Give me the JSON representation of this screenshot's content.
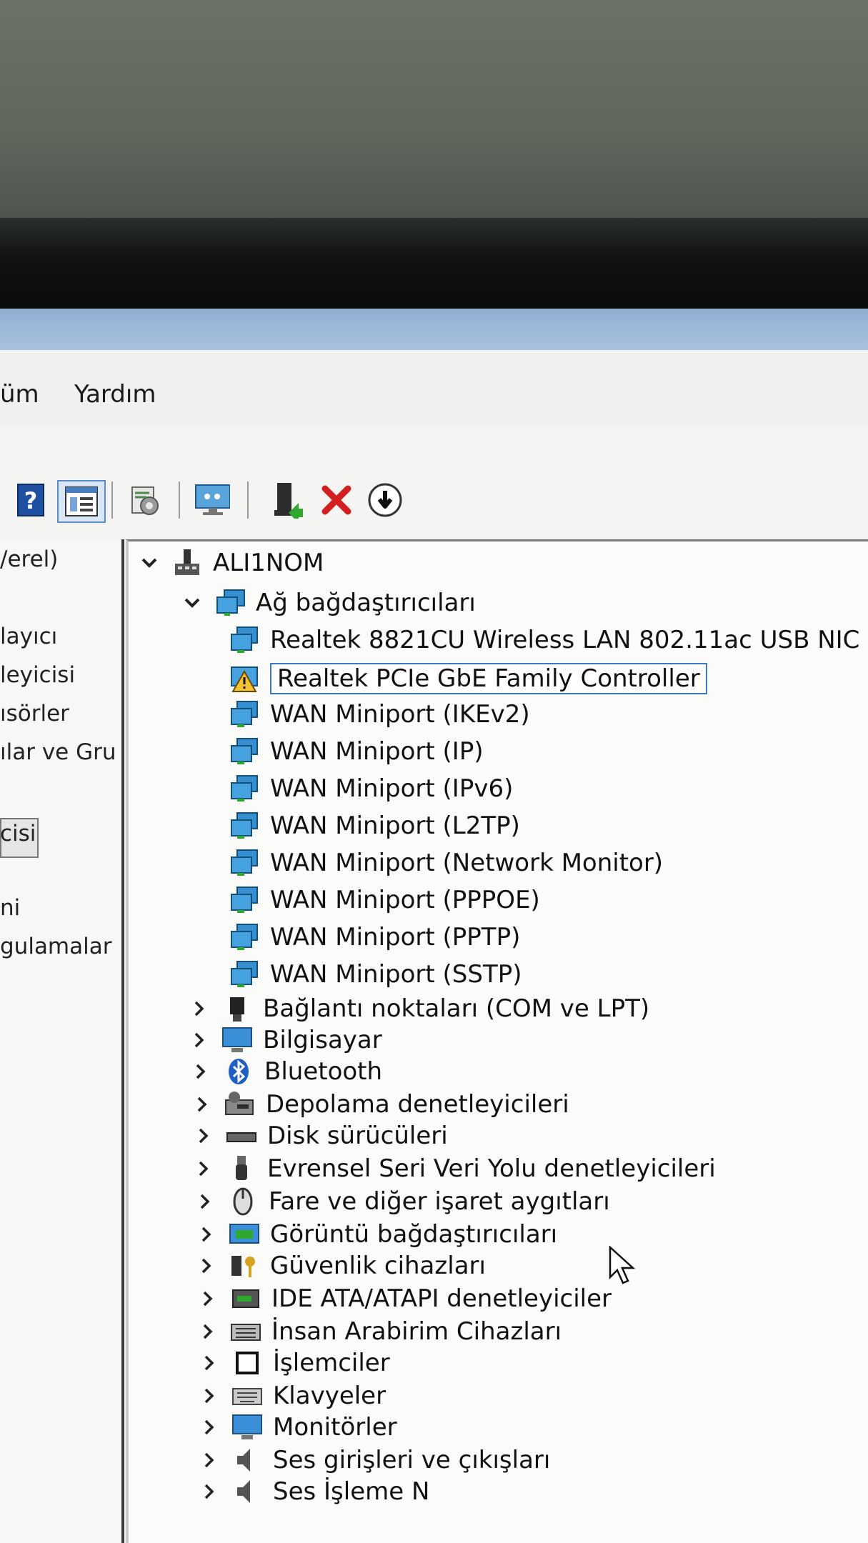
{
  "menu": {
    "item_0": "üm",
    "item_1": "Yardım"
  },
  "left_pane": {
    "items": [
      "/erel)",
      "layıcı",
      "leyicisi",
      "ısörler",
      "ılar ve Gru",
      "cisi",
      "ni",
      "gulamalar"
    ]
  },
  "tree": {
    "root": "ALI1NOM",
    "network_adapters": {
      "label": "Ağ bağdaştırıcıları",
      "children": [
        "Realtek 8821CU Wireless LAN 802.11ac USB NIC",
        "Realtek PCIe GbE Family Controller",
        "WAN Miniport (IKEv2)",
        "WAN Miniport (IP)",
        "WAN Miniport (IPv6)",
        "WAN Miniport (L2TP)",
        "WAN Miniport (Network Monitor)",
        "WAN Miniport (PPPOE)",
        "WAN Miniport (PPTP)",
        "WAN Miniport (SSTP)"
      ]
    },
    "categories": [
      {
        "label": "Bağlantı noktaları (COM ve LPT)",
        "icon": "port-icon"
      },
      {
        "label": "Bilgisayar",
        "icon": "computer-icon"
      },
      {
        "label": "Bluetooth",
        "icon": "bluetooth-icon"
      },
      {
        "label": "Depolama denetleyicileri",
        "icon": "storage-controller-icon"
      },
      {
        "label": "Disk sürücüleri",
        "icon": "disk-icon"
      },
      {
        "label": "Evrensel Seri Veri Yolu denetleyicileri",
        "icon": "usb-icon"
      },
      {
        "label": "Fare ve diğer işaret aygıtları",
        "icon": "mouse-icon"
      },
      {
        "label": "Görüntü bağdaştırıcıları",
        "icon": "display-adapter-icon"
      },
      {
        "label": "Güvenlik cihazları",
        "icon": "security-device-icon"
      },
      {
        "label": "IDE ATA/ATAPI denetleyiciler",
        "icon": "ide-icon"
      },
      {
        "label": "İnsan Arabirim Cihazları",
        "icon": "hid-icon"
      },
      {
        "label": "İşlemciler",
        "icon": "processor-icon"
      },
      {
        "label": "Klavyeler",
        "icon": "keyboard-icon"
      },
      {
        "label": "Monitörler",
        "icon": "monitor-icon"
      },
      {
        "label": "Ses girişleri ve çıkışları",
        "icon": "audio-icon"
      },
      {
        "label": "Ses İşleme N",
        "icon": "sound-processing-icon"
      }
    ]
  },
  "colors": {
    "selection_border": "#3a7ac6",
    "warning": "#f2c230",
    "network_icon": "#2f86c9",
    "remove_icon": "#d21f1f"
  }
}
